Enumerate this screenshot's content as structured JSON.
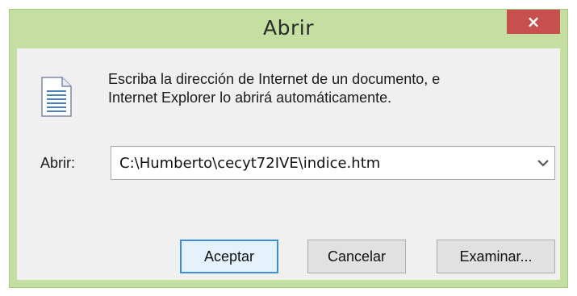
{
  "window": {
    "title": "Abrir",
    "close_label": "×"
  },
  "message": {
    "line1": "Escriba la dirección de Internet de un documento, e",
    "line2": "Internet Explorer lo abrirá automáticamente."
  },
  "open_field": {
    "label": "Abrir:",
    "value": "C:\\Humberto\\cecyt72IVE\\indice.htm"
  },
  "buttons": {
    "ok": "Aceptar",
    "cancel": "Cancelar",
    "browse": "Examinar..."
  },
  "colors": {
    "frame": "#c4dfa1",
    "close": "#c7504f",
    "client": "#f0f0f0",
    "default_button_border": "#3c8fd6"
  },
  "icons": {
    "document": "document-icon",
    "dropdown": "chevron-down-icon"
  }
}
